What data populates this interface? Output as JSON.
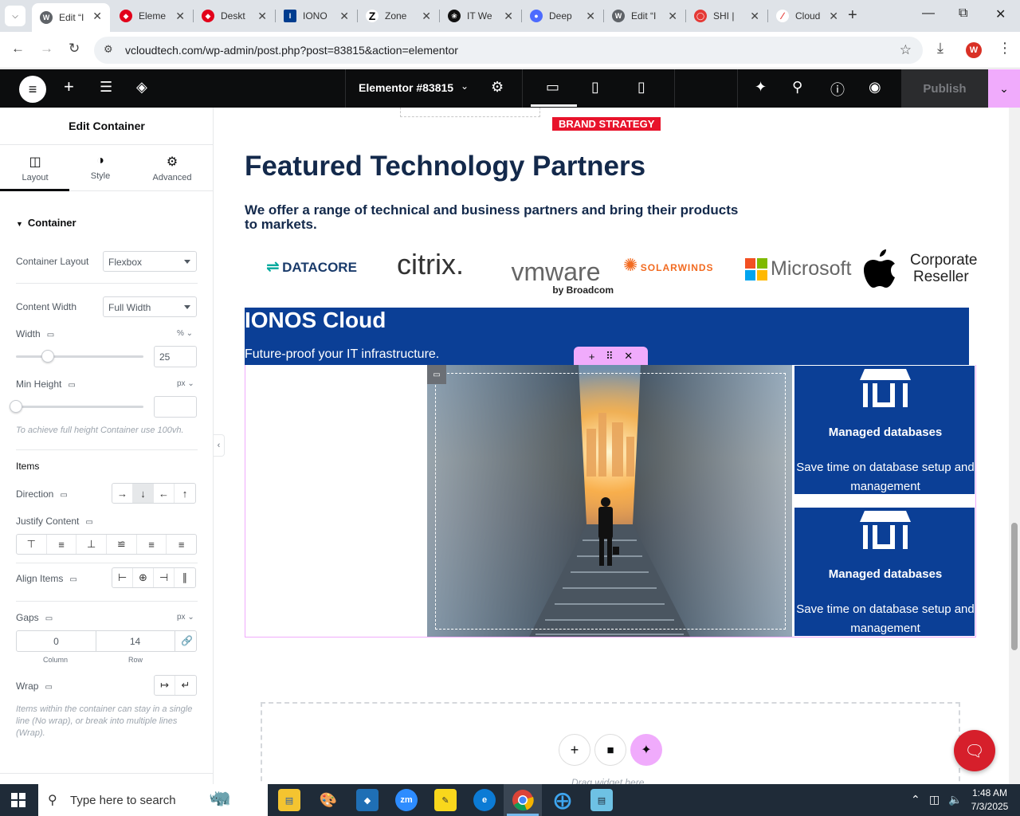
{
  "browser": {
    "tabs": [
      {
        "label": "Edit “I",
        "active": true
      },
      {
        "label": "Eleme"
      },
      {
        "label": "Deskt"
      },
      {
        "label": "IONO"
      },
      {
        "label": "Zone"
      },
      {
        "label": "IT We"
      },
      {
        "label": "Deep"
      },
      {
        "label": "Edit “I"
      },
      {
        "label": "SHI |"
      },
      {
        "label": "Cloud"
      }
    ],
    "url": "vcloudtech.com/wp-admin/post.php?post=83815&action=elementor",
    "profile_initial": "W"
  },
  "elementor": {
    "document_title": "Elementor #83815",
    "publish_label": "Publish"
  },
  "panel": {
    "title": "Edit Container",
    "tabs": [
      "Layout",
      "Style",
      "Advanced"
    ],
    "section": "Container",
    "container_layout": {
      "label": "Container Layout",
      "value": "Flexbox"
    },
    "content_width": {
      "label": "Content Width",
      "value": "Full Width"
    },
    "width": {
      "label": "Width",
      "unit": "%",
      "value": "25",
      "slider_fraction": 0.25
    },
    "min_height": {
      "label": "Min Height",
      "unit": "px",
      "value": "",
      "hint": "To achieve full height Container use 100vh."
    },
    "items_heading": "Items",
    "direction": {
      "label": "Direction",
      "selected": 1
    },
    "justify_content": {
      "label": "Justify Content"
    },
    "align_items": {
      "label": "Align Items"
    },
    "gaps": {
      "label": "Gaps",
      "unit": "px",
      "column": "0",
      "row": "14",
      "column_label": "Column",
      "row_label": "Row"
    },
    "wrap": {
      "label": "Wrap",
      "hint": "Items within the container can stay in a single line (No wrap), or break into multiple lines (Wrap)."
    }
  },
  "canvas": {
    "badge": "BRAND STRATEGY",
    "heading": "Featured Technology Partners",
    "subheading": "We offer a range of technical and business partners and bring their products to markets.",
    "logos": {
      "datacore": "DATACORE",
      "citrix": "citrix.",
      "vmware": "vmware",
      "vmware_sub": "by Broadcom",
      "solarwinds": "SOLARWINDS",
      "microsoft": "Microsoft",
      "apple_line1": "Corporate",
      "apple_line2": "Reseller"
    },
    "banner": {
      "title": "IONOS Cloud",
      "subtitle": "Future-proof your IT infrastructure."
    },
    "cards": [
      {
        "title": "Managed databases",
        "desc": "Save time on database setup and management"
      },
      {
        "title": "Managed databases",
        "desc": "Save time on database setup and management"
      }
    ],
    "drop_hint": "Drag widget here"
  },
  "taskbar": {
    "search_placeholder": "Type here to search",
    "time": "1:48 AM",
    "date": "7/3/2025"
  },
  "colors": {
    "ionos_blue": "#0b3f96",
    "brand_red": "#e8132b",
    "elementor_pink": "#f0abfc",
    "heading_navy": "#13294b"
  }
}
